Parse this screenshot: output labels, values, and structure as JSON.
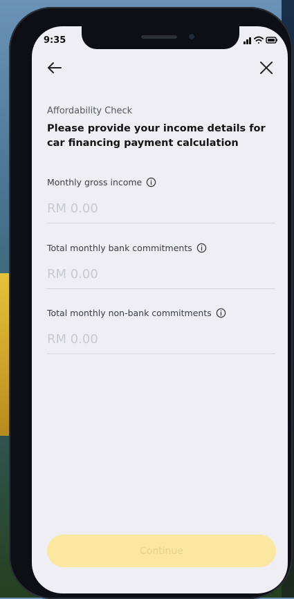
{
  "status": {
    "time": "9:35"
  },
  "header": {
    "eyebrow": "Affordability Check",
    "title": "Please provide your income details for car financing payment calculation"
  },
  "fields": [
    {
      "label": "Monthly gross income",
      "placeholder": "RM 0.00"
    },
    {
      "label": "Total monthly bank commitments",
      "placeholder": "RM 0.00"
    },
    {
      "label": "Total monthly non-bank commitments",
      "placeholder": "RM 0.00"
    }
  ],
  "footer": {
    "continue_label": "Continue"
  },
  "colors": {
    "accent": "#fbe7a0",
    "accent_text": "#ead28b",
    "screen_bg": "#eeeef4"
  }
}
